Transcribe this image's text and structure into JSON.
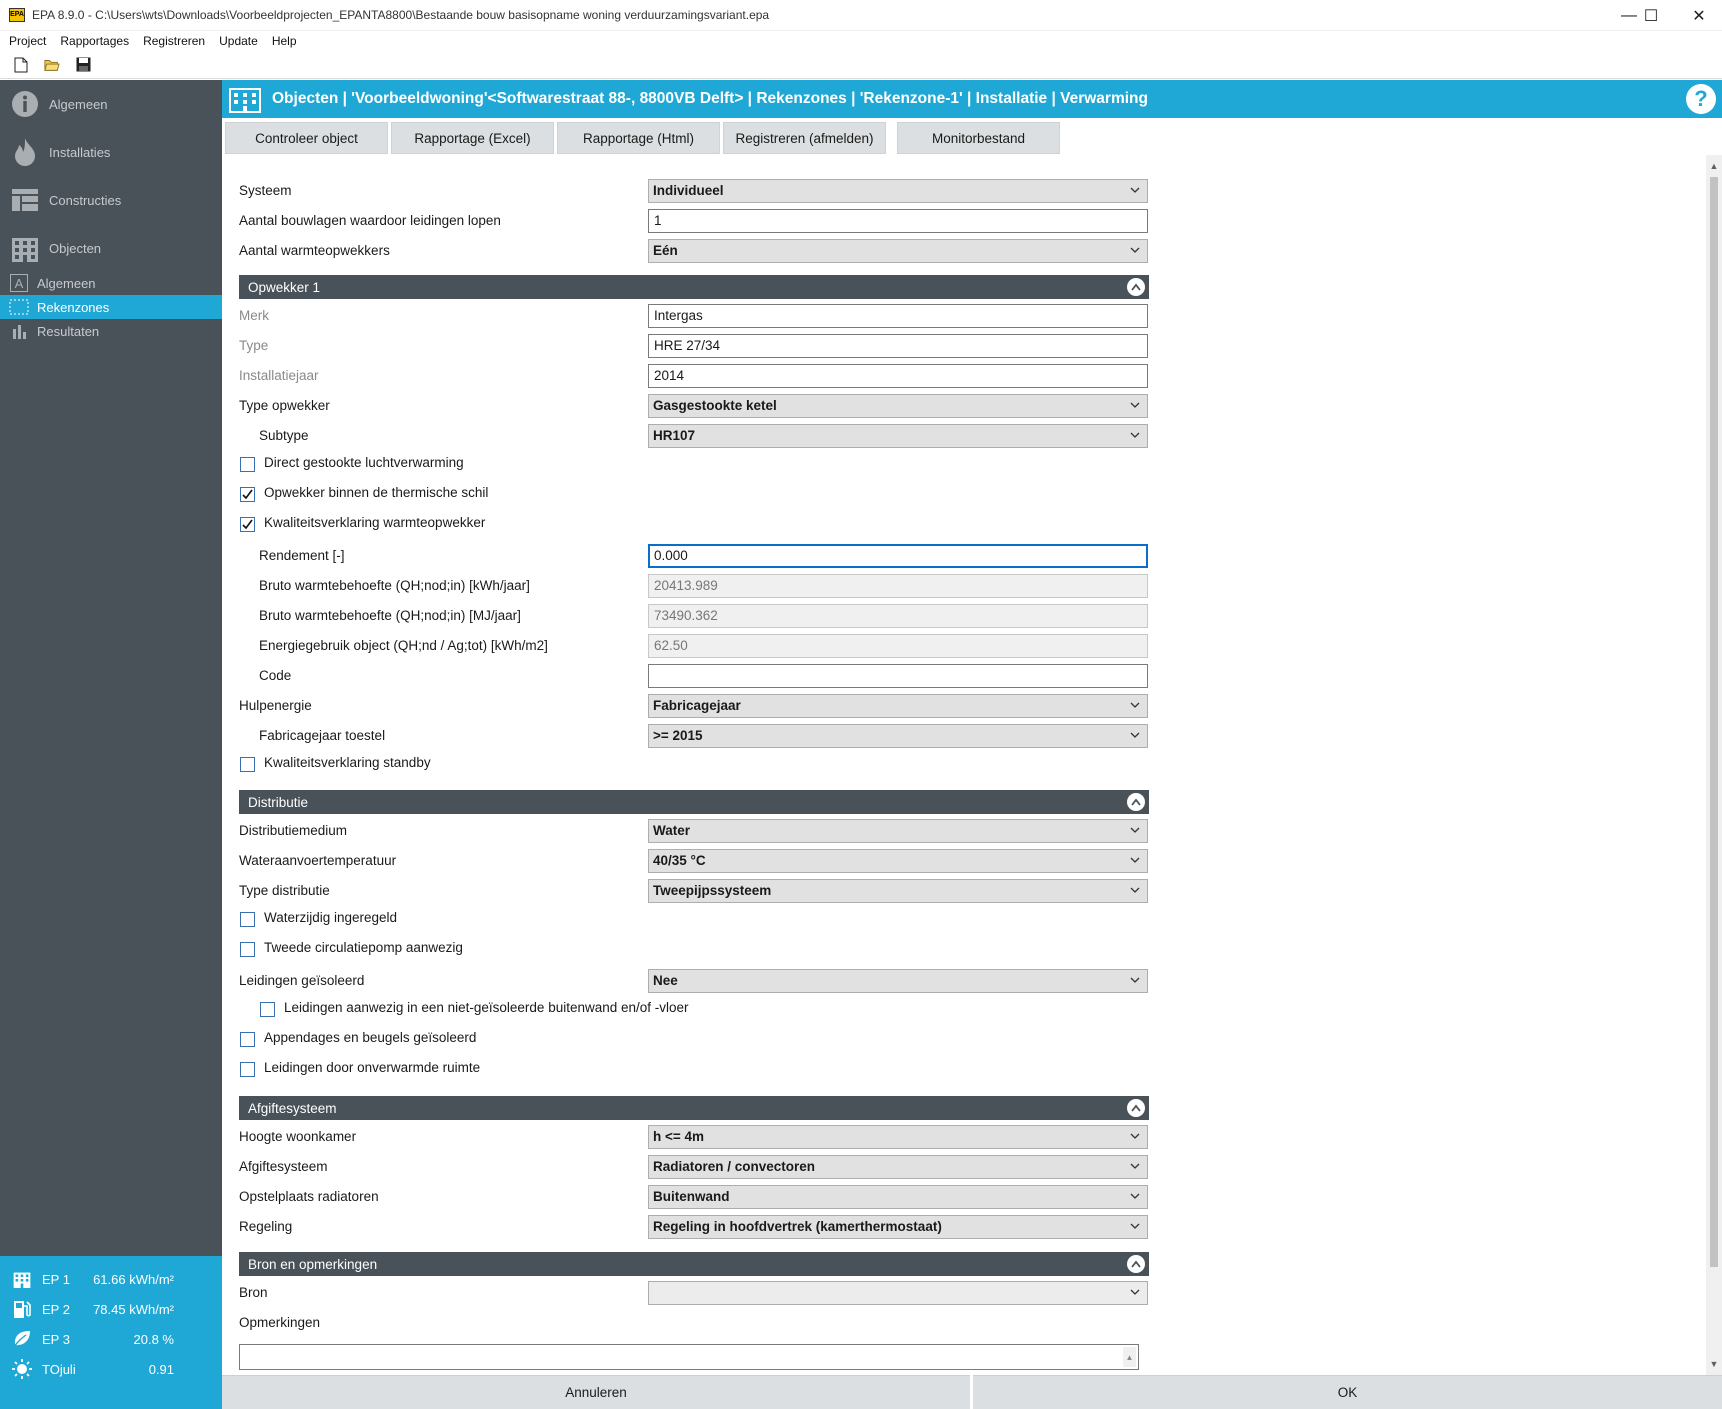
{
  "window": {
    "logo": "EPA",
    "title": "EPA 8.9.0 - C:\\Users\\wts\\Downloads\\Voorbeeldprojecten_EPANTA8800\\Bestaande bouw basisopname woning verduurzamingsvariant.epa",
    "minimize": "—",
    "maximize": "☐",
    "close": "✕"
  },
  "menu": [
    "Project",
    "Rapportages",
    "Registreren",
    "Update",
    "Help"
  ],
  "toolbar": [
    "new-file-icon",
    "open-folder-icon",
    "save-icon"
  ],
  "sidebar": {
    "main": [
      {
        "label": "Algemeen",
        "icon": "info-icon"
      },
      {
        "label": "Installaties",
        "icon": "flame-icon"
      },
      {
        "label": "Constructies",
        "icon": "construction-icon"
      },
      {
        "label": "Objecten",
        "icon": "building-icon"
      }
    ],
    "sub": [
      {
        "label": "Algemeen",
        "icon": "letter-a-icon",
        "active": false
      },
      {
        "label": "Rekenzones",
        "icon": "zone-icon",
        "active": true
      },
      {
        "label": "Resultaten",
        "icon": "bar-chart-icon",
        "active": false
      }
    ],
    "ep": [
      {
        "label": "EP 1",
        "value": "61.66 kWh/m²",
        "icon": "building-icon"
      },
      {
        "label": "EP 2",
        "value": "78.45 kWh/m²",
        "icon": "fuel-pump-icon"
      },
      {
        "label": "EP 3",
        "value": "20.8 %",
        "icon": "leaf-icon"
      },
      {
        "label": "TOjuli",
        "value": "0.91",
        "icon": "sun-icon"
      }
    ]
  },
  "header": {
    "breadcrumb": "Objecten | 'Voorbeeldwoning'<Softwarestraat 88-, 8800VB Delft> | Rekenzones | 'Rekenzone-1' | Installatie | Verwarming",
    "help": "?"
  },
  "tabs": [
    "Controleer object",
    "Rapportage (Excel)",
    "Rapportage (Html)",
    "Registreren (afmelden)",
    "Monitorbestand"
  ],
  "form": {
    "systeem": {
      "label": "Systeem",
      "value": "Individueel"
    },
    "aantal_bouwlagen": {
      "label": "Aantal bouwlagen waardoor leidingen lopen",
      "value": "1"
    },
    "aantal_opwekkers": {
      "label": "Aantal warmteopwekkers",
      "value": "Eén"
    },
    "opwekker_section": "Opwekker 1",
    "merk": {
      "label": "Merk",
      "value": "Intergas"
    },
    "type": {
      "label": "Type",
      "value": "HRE 27/34"
    },
    "installatiejaar": {
      "label": "Installatiejaar",
      "value": "2014"
    },
    "type_opwekker": {
      "label": "Type opwekker",
      "value": "Gasgestookte ketel"
    },
    "subtype": {
      "label": "Subtype",
      "value": "HR107"
    },
    "cb_direct": {
      "label": "Direct gestookte luchtverwarming",
      "checked": false
    },
    "cb_binnen": {
      "label": "Opwekker binnen de thermische schil",
      "checked": true
    },
    "cb_kwaliteit": {
      "label": "Kwaliteitsverklaring warmteopwekker",
      "checked": true
    },
    "rendement": {
      "label": "Rendement [-]",
      "value": "0.000"
    },
    "bruto_kwh": {
      "label": "Bruto warmtebehoefte (QH;nod;in) [kWh/jaar]",
      "value": "20413.989"
    },
    "bruto_mj": {
      "label": "Bruto warmtebehoefte (QH;nod;in) [MJ/jaar]",
      "value": "73490.362"
    },
    "energiegebruik": {
      "label": "Energiegebruik object (QH;nd / Ag;tot) [kWh/m2]",
      "value": "62.50"
    },
    "code": {
      "label": "Code",
      "value": ""
    },
    "hulpenergie": {
      "label": "Hulpenergie",
      "value": "Fabricagejaar"
    },
    "fabricagejaar": {
      "label": "Fabricagejaar toestel",
      "value": ">= 2015"
    },
    "cb_standby": {
      "label": "Kwaliteitsverklaring standby",
      "checked": false
    },
    "distributie_section": "Distributie",
    "distributiemedium": {
      "label": "Distributiemedium",
      "value": "Water"
    },
    "wateraanvoer": {
      "label": "Wateraanvoertemperatuur",
      "value": "40/35 °C"
    },
    "type_distributie": {
      "label": "Type distributie",
      "value": "Tweepijpssysteem"
    },
    "cb_waterzijdig": {
      "label": "Waterzijdig ingeregeld",
      "checked": false
    },
    "cb_tweede_pomp": {
      "label": "Tweede circulatiepomp aanwezig",
      "checked": false
    },
    "leidingen_geisoleerd": {
      "label": "Leidingen geïsoleerd",
      "value": "Nee"
    },
    "cb_leidingen_buitenwand": {
      "label": "Leidingen aanwezig in een niet-geïsoleerde buitenwand en/of -vloer",
      "checked": false
    },
    "cb_appendages": {
      "label": "Appendages en beugels geïsoleerd",
      "checked": false
    },
    "cb_onverwarmd": {
      "label": "Leidingen door onverwarmde ruimte",
      "checked": false
    },
    "afgifte_section": "Afgiftesysteem",
    "hoogte_woonkamer": {
      "label": "Hoogte woonkamer",
      "value": "h <= 4m"
    },
    "afgiftesysteem": {
      "label": "Afgiftesysteem",
      "value": "Radiatoren / convectoren"
    },
    "opstelplaats": {
      "label": "Opstelplaats radiatoren",
      "value": "Buitenwand"
    },
    "regeling": {
      "label": "Regeling",
      "value": "Regeling in hoofdvertrek (kamerthermostaat)"
    },
    "bron_section": "Bron en opmerkingen",
    "bron": {
      "label": "Bron",
      "value": ""
    },
    "opmerkingen": {
      "label": "Opmerkingen",
      "value": ""
    }
  },
  "footer": {
    "cancel": "Annuleren",
    "ok": "OK"
  },
  "colors": {
    "accent": "#1fa8d5",
    "sidebar": "#4a5259",
    "section": "#4a5259"
  }
}
